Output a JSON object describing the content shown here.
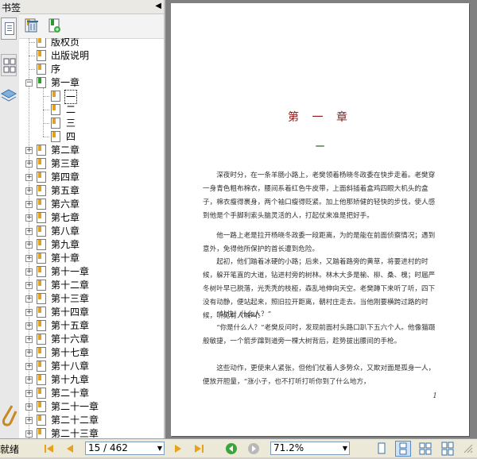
{
  "bookmarks": {
    "title": "书签",
    "items": [
      {
        "label": "版权页"
      },
      {
        "label": "出版说明"
      },
      {
        "label": "序"
      },
      {
        "label": "第一章"
      },
      {
        "label": "一"
      },
      {
        "label": "二"
      },
      {
        "label": "三"
      },
      {
        "label": "四"
      },
      {
        "label": "第二章"
      },
      {
        "label": "第三章"
      },
      {
        "label": "第四章"
      },
      {
        "label": "第五章"
      },
      {
        "label": "第六章"
      },
      {
        "label": "第七章"
      },
      {
        "label": "第八章"
      },
      {
        "label": "第九章"
      },
      {
        "label": "第十章"
      },
      {
        "label": "第十一章"
      },
      {
        "label": "第十二章"
      },
      {
        "label": "第十三章"
      },
      {
        "label": "第十四章"
      },
      {
        "label": "第十五章"
      },
      {
        "label": "第十六章"
      },
      {
        "label": "第十七章"
      },
      {
        "label": "第十八章"
      },
      {
        "label": "第十九章"
      },
      {
        "label": "第二十章"
      },
      {
        "label": "第二十一章"
      },
      {
        "label": "第二十二章"
      },
      {
        "label": "第二十三章"
      }
    ]
  },
  "page": {
    "chapter_title": "第 一 章",
    "chapter_number": "一",
    "paragraphs": [
      "深夜时分，在一条羊肠小路上，老樊领着杨晓冬政委在快步走着。老樊穿一身青色粗布棉衣，腰间系着红色牛皮带，上面斜插着盒鸡四眼大机头的盒子，棉衣瘦得裹身，两个袖口瘦得贬紧。加上他那矫健的轻快的步伐，使人感到他是个手脚利索头脑灵活的人，打起仗来准是把好手。",
      "他一路上老是拉开杨晓冬政委一段距离，为的是能在前面侦察情况；遇到意外，免得他所保护的首长遭到危险。",
      "起初，他们踏着冰硬的小路；后来，又踏着路旁的黄草，将要进村的时候，躲开笔直的大道，钻进村旁的树林。林木大多是榆、柳、桑、槐；时届严冬树叶早已脱落，光秃秃的枝桠，森乱地伸向天空。老樊蹲下来听了听，四下没有动静，便站起来，照旧拉开距离，朝村庄走去。当他刚要横跨过路的时候，听见有人喊叫：",
      "“站住！什么人？”",
      "“你是什么人？”老樊反问时，发现前面村头路口趴下五六个人。他像猫蹑般敏捷，一个箭步蹿到道旁一棵大树背后，趁势拔出腰间的手枪。",
      "这些动作，更使来人紧张，但他们仗着人多势众，又欺对面是孤身一人，便放开胆量，“涨小子，也不打听打听你到了什么地方，"
    ],
    "page_number": "1"
  },
  "status": {
    "text": "就绪",
    "page_field": "15 / 462",
    "zoom": "71.2%"
  }
}
